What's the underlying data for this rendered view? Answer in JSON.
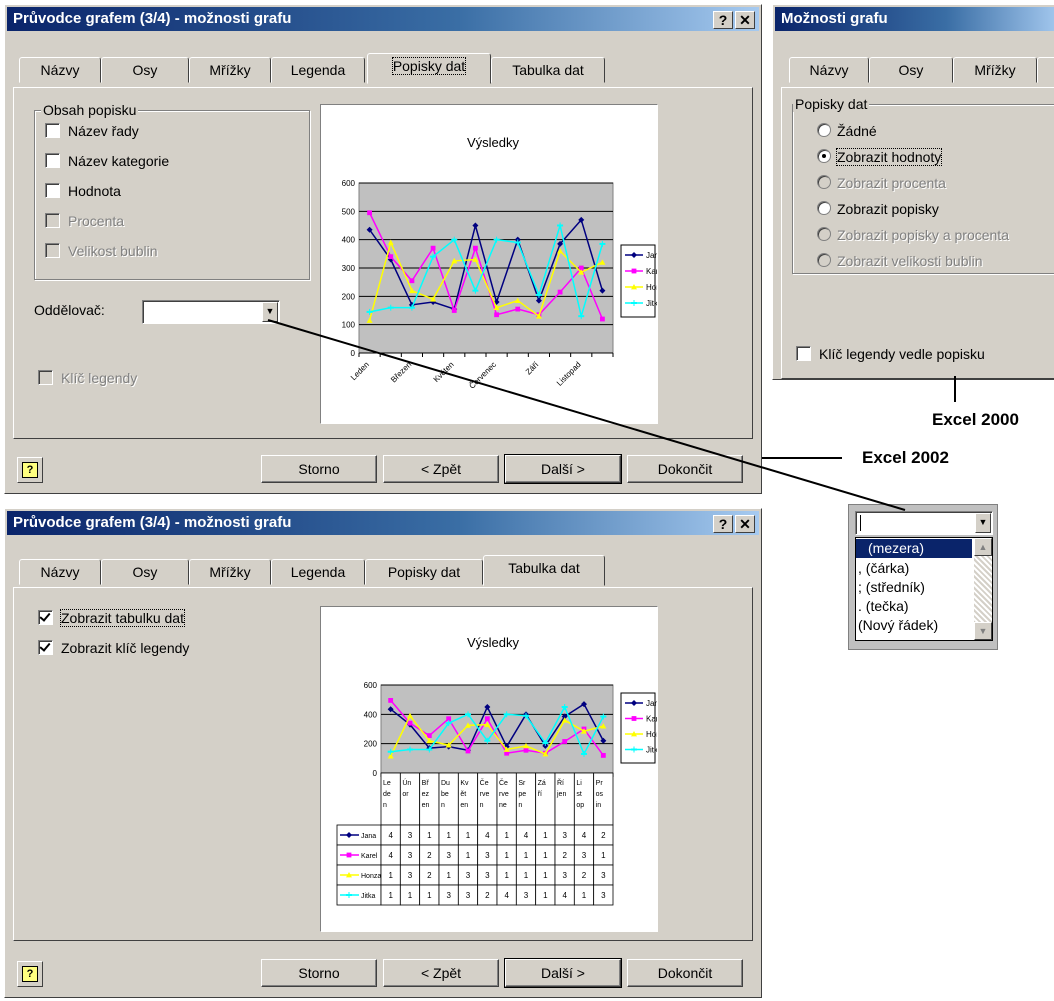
{
  "dialog1": {
    "title": "Průvodce grafem (3/4) - možnosti grafu",
    "help_btn": "?",
    "close_btn": "✕",
    "tabs": [
      "Názvy",
      "Osy",
      "Mřížky",
      "Legenda",
      "Popisky dat",
      "Tabulka dat"
    ],
    "group_label": "Obsah popisku",
    "checks": [
      "Název řady",
      "Název kategorie",
      "Hodnota",
      "Procenta",
      "Velikost bublin"
    ],
    "separator_label": "Oddělovač:",
    "legend_key": "Klíč legendy",
    "buttons": {
      "cancel": "Storno",
      "back": "< Zpět",
      "next": "Další >",
      "finish": "Dokončit"
    }
  },
  "dialog2": {
    "title": "Průvodce grafem (3/4) - možnosti grafu",
    "help_btn": "?",
    "close_btn": "✕",
    "tabs": [
      "Názvy",
      "Osy",
      "Mřížky",
      "Legenda",
      "Popisky dat",
      "Tabulka dat"
    ],
    "show_table": "Zobrazit tabulku dat",
    "show_legend_key": "Zobrazit klíč legendy",
    "buttons": {
      "cancel": "Storno",
      "back": "< Zpět",
      "next": "Další >",
      "finish": "Dokončit"
    }
  },
  "dialog3": {
    "title": "Možnosti grafu",
    "tabs": [
      "Názvy",
      "Osy",
      "Mřížky"
    ],
    "group_label": "Popisky dat",
    "radios": [
      "Žádné",
      "Zobrazit hodnoty",
      "Zobrazit procenta",
      "Zobrazit popisky",
      "Zobrazit popisky a procenta",
      "Zobrazit velikosti bublin"
    ],
    "legend_key": "Klíč legendy vedle popisku"
  },
  "dropdown": {
    "items": [
      "(mezera)",
      ", (čárka)",
      "; (středník)",
      ". (tečka)",
      "(Nový řádek)"
    ]
  },
  "captions": {
    "excel2000": "Excel 2000",
    "excel2002": "Excel 2002"
  },
  "chart_data": [
    {
      "type": "line",
      "title": "Výsledky",
      "ylim": [
        0,
        600
      ],
      "yticks": [
        "0",
        "100",
        "200",
        "300",
        "400",
        "500",
        "600"
      ],
      "xtick_labels": [
        "Leden",
        "Březen",
        "Květen",
        "Červenec",
        "Září",
        "Listopad"
      ],
      "categories": [
        "Leden",
        "Únor",
        "Březen",
        "Duben",
        "Květen",
        "Červen",
        "Červenec",
        "Srpen",
        "Září",
        "Říjen",
        "Listopad",
        "Prosinec"
      ],
      "legend": "right",
      "series": [
        {
          "name": "Jana",
          "color": "#000080",
          "marker": "diamond",
          "values": [
            435,
            330,
            170,
            180,
            155,
            450,
            180,
            400,
            185,
            385,
            470,
            220
          ]
        },
        {
          "name": "Karel",
          "color": "#ff00ff",
          "marker": "square",
          "values": [
            495,
            340,
            255,
            370,
            150,
            370,
            135,
            155,
            135,
            215,
            300,
            120
          ]
        },
        {
          "name": "Honza",
          "color": "#ffff00",
          "marker": "triangle",
          "values": [
            115,
            390,
            220,
            190,
            325,
            330,
            160,
            185,
            130,
            360,
            285,
            320
          ]
        },
        {
          "name": "Jitka",
          "color": "#00ffff",
          "marker": "star",
          "values": [
            145,
            160,
            160,
            340,
            400,
            220,
            400,
            390,
            205,
            450,
            130,
            385
          ]
        }
      ]
    },
    {
      "type": "line",
      "title": "Výsledky",
      "ylim": [
        0,
        600
      ],
      "yticks": [
        "0",
        "200",
        "400",
        "600"
      ],
      "legend": "right",
      "table_headers": [
        "Le de n",
        "Ún or",
        "Bř ez en",
        "Du be n",
        "Kv ět en",
        "Če rve n",
        "Če rve ne",
        "Sr pe n",
        "Zá ří",
        "Ří jen",
        "Li st op",
        "Pr os in"
      ],
      "series": [
        {
          "name": "Jana",
          "color": "#000080",
          "marker": "diamond",
          "values": [
            435,
            330,
            170,
            180,
            155,
            450,
            180,
            400,
            185,
            385,
            470,
            220
          ],
          "table": [
            "4",
            "3",
            "1",
            "1",
            "1",
            "4",
            "1",
            "4",
            "1",
            "3",
            "4",
            "2"
          ]
        },
        {
          "name": "Karel",
          "color": "#ff00ff",
          "marker": "square",
          "values": [
            495,
            340,
            255,
            370,
            150,
            370,
            135,
            155,
            135,
            215,
            300,
            120
          ],
          "table": [
            "4",
            "3",
            "2",
            "3",
            "1",
            "3",
            "1",
            "1",
            "1",
            "2",
            "3",
            "1"
          ]
        },
        {
          "name": "Honza",
          "color": "#ffff00",
          "marker": "triangle",
          "values": [
            115,
            390,
            220,
            190,
            325,
            330,
            160,
            185,
            130,
            360,
            285,
            320
          ],
          "table": [
            "1",
            "3",
            "2",
            "1",
            "3",
            "3",
            "1",
            "1",
            "1",
            "3",
            "2",
            "3"
          ]
        },
        {
          "name": "Jitka",
          "color": "#00ffff",
          "marker": "star",
          "values": [
            145,
            160,
            160,
            340,
            400,
            220,
            400,
            390,
            205,
            450,
            130,
            385
          ],
          "table": [
            "1",
            "1",
            "1",
            "3",
            "3",
            "2",
            "4",
            "3",
            "1",
            "4",
            "1",
            "3"
          ]
        }
      ]
    }
  ]
}
